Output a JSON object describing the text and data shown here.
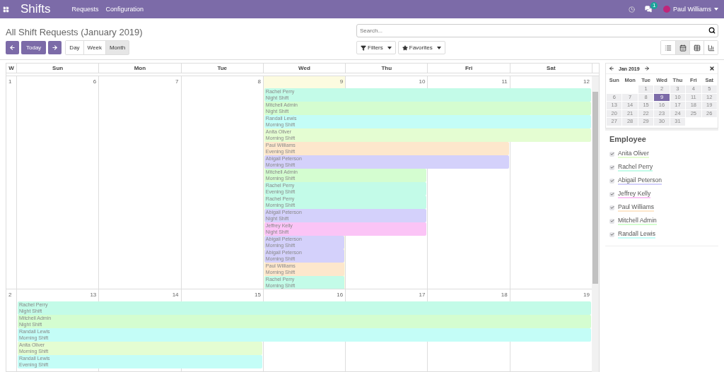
{
  "topbar": {
    "app": "Shifts",
    "menu": [
      "Requests",
      "Configuration"
    ],
    "badge": "1",
    "user": "Paul Williams"
  },
  "title": "All Shift Requests (January 2019)",
  "nav": {
    "today": "Today",
    "scales": [
      {
        "label": "Day",
        "selected": false
      },
      {
        "label": "Week",
        "selected": false
      },
      {
        "label": "Month",
        "selected": true
      }
    ]
  },
  "search": {
    "placeholder": "Search..."
  },
  "search_menus": [
    {
      "label": "Filters",
      "kind": "filter"
    },
    {
      "label": "Favorites",
      "kind": "star"
    }
  ],
  "views": [
    {
      "kind": "list",
      "selected": false
    },
    {
      "kind": "calendar",
      "selected": true
    },
    {
      "kind": "pivot",
      "selected": false
    },
    {
      "kind": "graph",
      "selected": false
    }
  ],
  "calendar": {
    "week_label": "W",
    "days": [
      "Sun",
      "Mon",
      "Tue",
      "Wed",
      "Thu",
      "Fri",
      "Sat"
    ],
    "weeks": [
      {
        "number": "1",
        "dates": [
          {
            "label": "6",
            "today": false
          },
          {
            "label": "7",
            "today": false
          },
          {
            "label": "8",
            "today": false
          },
          {
            "label": "9",
            "today": true
          },
          {
            "label": "10",
            "today": false
          },
          {
            "label": "11",
            "today": false
          },
          {
            "label": "12",
            "today": false
          }
        ],
        "events": [
          {
            "name": "Rachel Perry",
            "shift": "Night Shift",
            "color": "#c3fbe8",
            "days": [
              false,
              false,
              false,
              true,
              true,
              true,
              true
            ]
          },
          {
            "name": "Mitchell Admin",
            "shift": "Night Shift",
            "color": "#d4fdd0",
            "days": [
              false,
              false,
              false,
              true,
              true,
              true,
              true
            ]
          },
          {
            "name": "Randall Lewis",
            "shift": "Morning Shift",
            "color": "#c4fdf7",
            "days": [
              false,
              false,
              false,
              true,
              true,
              true,
              true
            ]
          },
          {
            "name": "Anita Oliver",
            "shift": "Morning Shift",
            "color": "#e4fdd2",
            "days": [
              false,
              false,
              false,
              true,
              true,
              true,
              true
            ]
          },
          {
            "name": "Paul Williams",
            "shift": "Evening Shift",
            "color": "#fde7cc",
            "days": [
              false,
              false,
              false,
              true,
              true,
              true,
              false
            ]
          },
          {
            "name": "Abigail Peterson",
            "shift": "Morning Shift",
            "color": "#d4d1fb",
            "days": [
              false,
              false,
              false,
              true,
              true,
              true,
              false
            ]
          },
          {
            "name": "Mitchell Admin",
            "shift": "Morning Shift",
            "color": "#d4fdd0",
            "days": [
              false,
              false,
              false,
              true,
              true,
              false,
              false
            ]
          },
          {
            "name": "Rachel Perry",
            "shift": "Evening Shift",
            "color": "#c3fbe8",
            "days": [
              false,
              false,
              false,
              true,
              true,
              false,
              false
            ]
          },
          {
            "name": "Rachel Perry",
            "shift": "Morning Shift",
            "color": "#c3fbe8",
            "days": [
              false,
              false,
              false,
              true,
              true,
              false,
              false
            ]
          },
          {
            "name": "Abigail Peterson",
            "shift": "Night Shift",
            "color": "#d4d1fb",
            "days": [
              false,
              false,
              false,
              true,
              true,
              false,
              false
            ]
          },
          {
            "name": "Jeffrey Kelly",
            "shift": "Night Shift",
            "color": "#fbc4f6",
            "days": [
              false,
              false,
              false,
              true,
              true,
              false,
              false
            ]
          },
          {
            "name": "Abigail Peterson",
            "shift": "Morning Shift",
            "color": "#d4d1fb",
            "days": [
              false,
              false,
              false,
              true,
              false,
              false,
              false
            ]
          },
          {
            "name": "Abigail Peterson",
            "shift": "Morning Shift",
            "color": "#d4d1fb",
            "days": [
              false,
              false,
              false,
              true,
              false,
              false,
              false
            ]
          },
          {
            "name": "Paul Williams",
            "shift": "Morning Shift",
            "color": "#fde7cc",
            "days": [
              false,
              false,
              false,
              true,
              false,
              false,
              false
            ]
          },
          {
            "name": "Rachel Perry",
            "shift": "Morning Shift",
            "color": "#c3fbe8",
            "days": [
              false,
              false,
              false,
              true,
              false,
              false,
              false
            ]
          }
        ]
      },
      {
        "number": "2",
        "dates": [
          {
            "label": "13",
            "today": false
          },
          {
            "label": "14",
            "today": false
          },
          {
            "label": "15",
            "today": false
          },
          {
            "label": "16",
            "today": false
          },
          {
            "label": "17",
            "today": false
          },
          {
            "label": "18",
            "today": false
          },
          {
            "label": "19",
            "today": false
          }
        ],
        "events": [
          {
            "name": "Rachel Perry",
            "shift": "Night Shift",
            "color": "#c3fbe8",
            "days": [
              true,
              true,
              true,
              true,
              true,
              true,
              true
            ]
          },
          {
            "name": "Mitchell Admin",
            "shift": "Night Shift",
            "color": "#d4fdd0",
            "days": [
              true,
              true,
              true,
              true,
              true,
              true,
              true
            ]
          },
          {
            "name": "Randall Lewis",
            "shift": "Morning Shift",
            "color": "#c4fdf7",
            "days": [
              true,
              true,
              true,
              true,
              true,
              true,
              true
            ]
          },
          {
            "name": "Anita Oliver",
            "shift": "Morning Shift",
            "color": "#e4fdd2",
            "days": [
              true,
              true,
              true,
              false,
              false,
              false,
              false
            ]
          },
          {
            "name": "Randall Lewis",
            "shift": "Evening Shift",
            "color": "#c4fdf7",
            "days": [
              true,
              true,
              true,
              false,
              false,
              false,
              false
            ]
          }
        ]
      }
    ]
  },
  "mini_calendar": {
    "month": "Jan 2019",
    "days": [
      "Sun",
      "Mon",
      "Tue",
      "Wed",
      "Thu",
      "Fri",
      "Sat"
    ],
    "weeks": [
      [
        {
          "label": "1",
          "selected": false
        },
        {
          "label": "2",
          "selected": false
        },
        {
          "label": "3",
          "selected": false
        },
        {
          "label": "4",
          "selected": false
        },
        {
          "label": "5",
          "selected": false
        }
      ],
      [
        {
          "label": "6",
          "selected": false
        },
        {
          "label": "7",
          "selected": false
        },
        {
          "label": "8",
          "selected": false
        },
        {
          "label": "9",
          "selected": true
        },
        {
          "label": "10",
          "selected": false
        },
        {
          "label": "11",
          "selected": false
        },
        {
          "label": "12",
          "selected": false
        }
      ],
      [
        {
          "label": "13",
          "selected": false
        },
        {
          "label": "14",
          "selected": false
        },
        {
          "label": "15",
          "selected": false
        },
        {
          "label": "16",
          "selected": false
        },
        {
          "label": "17",
          "selected": false
        },
        {
          "label": "18",
          "selected": false
        },
        {
          "label": "19",
          "selected": false
        }
      ],
      [
        {
          "label": "20",
          "selected": false
        },
        {
          "label": "21",
          "selected": false
        },
        {
          "label": "22",
          "selected": false
        },
        {
          "label": "23",
          "selected": false
        },
        {
          "label": "24",
          "selected": false
        },
        {
          "label": "25",
          "selected": false
        },
        {
          "label": "26",
          "selected": false
        }
      ],
      [
        {
          "label": "27",
          "selected": false
        },
        {
          "label": "28",
          "selected": false
        },
        {
          "label": "29",
          "selected": false
        },
        {
          "label": "30",
          "selected": false
        },
        {
          "label": "31",
          "selected": false
        }
      ]
    ]
  },
  "employees": {
    "title": "Employee",
    "items": [
      {
        "name": "Anita Oliver",
        "color": "#e4fdd2",
        "checked": true
      },
      {
        "name": "Rachel Perry",
        "color": "#c3fbe8",
        "checked": true
      },
      {
        "name": "Abigail Peterson",
        "color": "#d4d1fb",
        "checked": true
      },
      {
        "name": "Jeffrey Kelly",
        "color": "#fbc4f6",
        "checked": true
      },
      {
        "name": "Paul Williams",
        "color": "#fde7cc",
        "checked": true
      },
      {
        "name": "Mitchell Admin",
        "color": "#d4fdd0",
        "checked": true
      },
      {
        "name": "Randall Lewis",
        "color": "#c4fdf7",
        "checked": true
      }
    ]
  }
}
